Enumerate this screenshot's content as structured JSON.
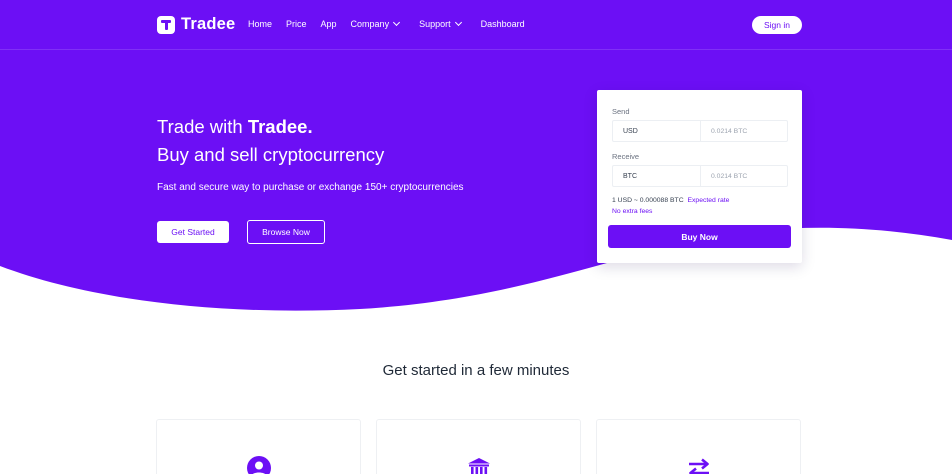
{
  "colors": {
    "brand": "#6c0ff5",
    "white": "#ffffff"
  },
  "header": {
    "logo_text": "Tradee",
    "nav": [
      {
        "label": "Home",
        "dropdown": false
      },
      {
        "label": "Price",
        "dropdown": false
      },
      {
        "label": "App",
        "dropdown": false
      },
      {
        "label": "Company",
        "dropdown": true
      },
      {
        "label": "Support",
        "dropdown": true
      },
      {
        "label": "Dashboard",
        "dropdown": false
      }
    ],
    "signin_label": "Sign in"
  },
  "hero": {
    "title_prefix": "Trade with ",
    "title_brand": "Tradee.",
    "title_line2": "Buy and sell cryptocurrency",
    "subtitle": "Fast and secure way to purchase or exchange 150+ cryptocurrencies",
    "primary_button": "Get Started",
    "secondary_button": "Browse Now"
  },
  "exchange": {
    "send_label": "Send",
    "send_currency": "USD",
    "send_amount": "0.0214 BTC",
    "receive_label": "Receive",
    "receive_currency": "BTC",
    "receive_amount": "0.0214 BTC",
    "rate_text": "1 USD ~ 0.000088 BTC",
    "rate_link": "Expected rate",
    "fees_text": "No extra fees",
    "buy_button": "Buy Now"
  },
  "section": {
    "title": "Get started in a few minutes",
    "features": [
      {
        "icon": "user-icon"
      },
      {
        "icon": "bank-icon"
      },
      {
        "icon": "exchange-arrows-icon"
      }
    ]
  }
}
